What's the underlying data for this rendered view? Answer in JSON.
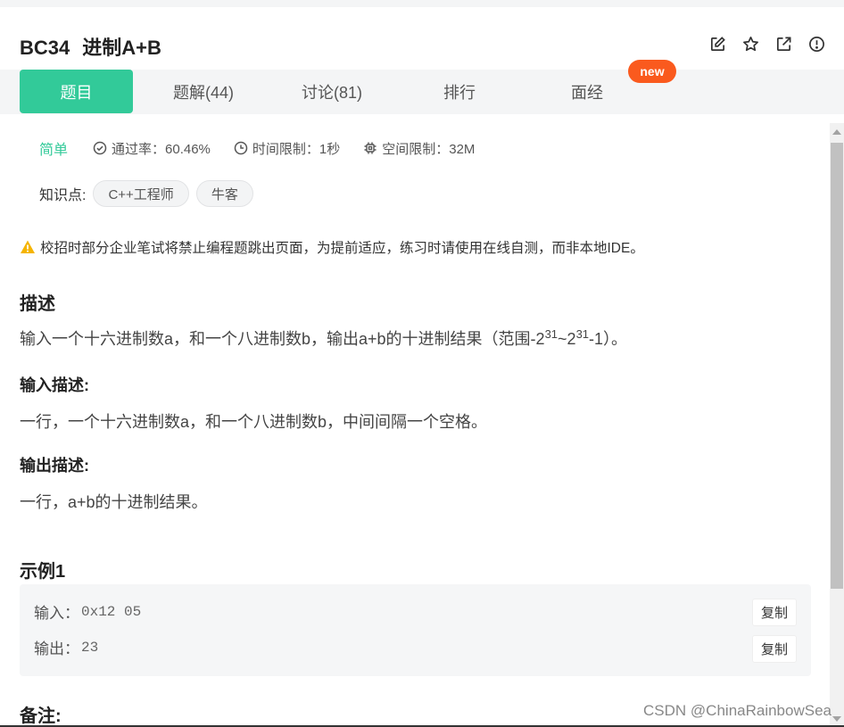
{
  "header": {
    "code": "BC34",
    "name": "进制A+B",
    "icons": [
      "edit-icon",
      "star-icon",
      "external-link-icon",
      "info-icon"
    ]
  },
  "tabs": [
    {
      "label": "题目",
      "active": true
    },
    {
      "label": "题解(44)"
    },
    {
      "label": "讨论(81)"
    },
    {
      "label": "排行"
    },
    {
      "label": "面经",
      "badge": "new"
    }
  ],
  "meta": {
    "level": "简单",
    "pass_rate": "通过率：60.46%",
    "time_limit": "时间限制：1秒",
    "space_limit": "空间限制：32M"
  },
  "knowledge": {
    "label": "知识点:",
    "tags": [
      "C++工程师",
      "牛客"
    ]
  },
  "warning": "校招时部分企业笔试将禁止编程题跳出页面，为提前适应，练习时请使用在线自测，而非本地IDE。",
  "description": {
    "heading": "描述",
    "text_before": "输入一个十六进制数a，和一个八进制数b，输出a+b的十进制结果（范围-2",
    "exp1": "31",
    "text_mid": "~2",
    "exp2": "31",
    "text_after": "-1）。"
  },
  "input_desc": {
    "heading": "输入描述:",
    "text": "一行，一个十六进制数a，和一个八进制数b，中间间隔一个空格。"
  },
  "output_desc": {
    "heading": "输出描述:",
    "text": "一行，a+b的十进制结果。"
  },
  "example": {
    "heading": "示例1",
    "input_label": "输入：",
    "input_value": "0x12 05",
    "output_label": "输出：",
    "output_value": "23",
    "copy_label": "复制"
  },
  "notes_heading": "备注:",
  "watermark": "CSDN @ChinaRainbowSea",
  "colors": {
    "accent": "#32ca99",
    "badge": "#fa5a1e",
    "warning": "#f5b400"
  }
}
